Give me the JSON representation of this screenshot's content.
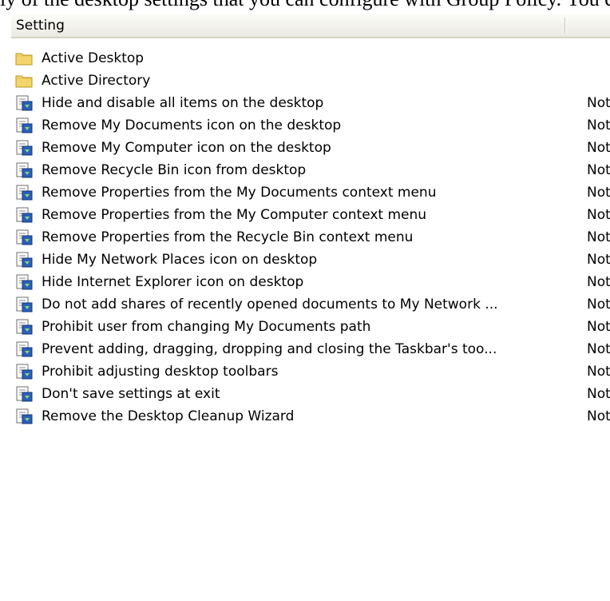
{
  "caption": "ly of the desktop settings that you can configure with Group Policy. You can see the following options:",
  "header": {
    "setting_label": "Setting",
    "state_label": ""
  },
  "folders": [
    {
      "label": "Active Desktop",
      "icon": "folder-icon"
    },
    {
      "label": "Active Directory",
      "icon": "folder-icon"
    }
  ],
  "settings": [
    {
      "label": "Hide and disable all items on the desktop",
      "state": "Not configured",
      "icon": "policy-setting-icon"
    },
    {
      "label": "Remove My Documents icon on the desktop",
      "state": "Not configured",
      "icon": "policy-setting-icon"
    },
    {
      "label": "Remove My Computer icon on the desktop",
      "state": "Not configured",
      "icon": "policy-setting-icon"
    },
    {
      "label": "Remove Recycle Bin icon from desktop",
      "state": "Not configured",
      "icon": "policy-setting-icon"
    },
    {
      "label": "Remove Properties from the My Documents context menu",
      "state": "Not configured",
      "icon": "policy-setting-icon"
    },
    {
      "label": "Remove Properties from the My Computer context menu",
      "state": "Not configured",
      "icon": "policy-setting-icon"
    },
    {
      "label": "Remove Properties from the Recycle Bin context menu",
      "state": "Not configured",
      "icon": "policy-setting-icon"
    },
    {
      "label": "Hide My Network Places icon on desktop",
      "state": "Not configured",
      "icon": "policy-setting-icon"
    },
    {
      "label": "Hide Internet Explorer icon on desktop",
      "state": "Not configured",
      "icon": "policy-setting-icon"
    },
    {
      "label": "Do not add shares of recently opened documents to My Network ...",
      "state": "Not configured",
      "icon": "policy-setting-icon"
    },
    {
      "label": "Prohibit user from changing My Documents path",
      "state": "Not configured",
      "icon": "policy-setting-icon"
    },
    {
      "label": "Prevent adding, dragging, dropping and closing the Taskbar's too...",
      "state": "Not configured",
      "icon": "policy-setting-icon"
    },
    {
      "label": "Prohibit adjusting desktop toolbars",
      "state": "Not configured",
      "icon": "policy-setting-icon"
    },
    {
      "label": "Don't save settings at exit",
      "state": "Not configured",
      "icon": "policy-setting-icon"
    },
    {
      "label": "Remove the Desktop Cleanup Wizard",
      "state": "Not configured",
      "icon": "policy-setting-icon"
    }
  ],
  "colors": {
    "folder": "#f2d66b",
    "folder_border": "#b8952a",
    "header_bg": "#ebeae2"
  }
}
